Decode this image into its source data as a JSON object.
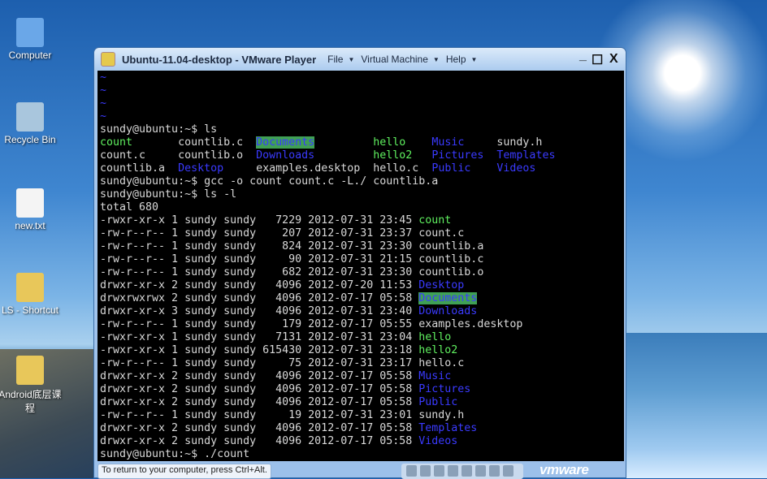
{
  "desktop": {
    "icons": [
      {
        "label": "Computer",
        "color": "#6aa7e8"
      },
      {
        "label": "Recycle Bin",
        "color": "#a9c6dd"
      },
      {
        "label": "new.txt",
        "color": "#f4f4f4"
      },
      {
        "label": "LS - Shortcut",
        "color": "#e8c75a"
      },
      {
        "label": "Android底层课程",
        "color": "#e8c75a"
      }
    ]
  },
  "window": {
    "title": "Ubuntu-11.04-desktop - VMware Player",
    "menus": [
      "File",
      "Virtual Machine",
      "Help"
    ],
    "minimize": "_",
    "maximize": "☐",
    "close": "X"
  },
  "status": {
    "message": "To return to your computer, press Ctrl+Alt.",
    "logo": "vmware"
  },
  "colors": {
    "green": "#5ff05f",
    "blue": "#3a3aff",
    "dir_hl_bg": "#3fa055",
    "tilde": "#3a3aff",
    "text": "#d8d8d8"
  },
  "terminal": {
    "lines": [
      [
        {
          "t": "~",
          "c": "tilde"
        }
      ],
      [
        {
          "t": "~",
          "c": "tilde"
        }
      ],
      [
        {
          "t": "~",
          "c": "tilde"
        }
      ],
      [
        {
          "t": "~",
          "c": "tilde"
        }
      ],
      [
        {
          "t": "sundy@ubuntu:~$ ls"
        }
      ],
      [
        {
          "t": "count",
          "c": "green"
        },
        {
          "t": "       countlib.c  "
        },
        {
          "t": "Documents",
          "c": "hl"
        },
        {
          "t": "         "
        },
        {
          "t": "hello",
          "c": "green"
        },
        {
          "t": "    "
        },
        {
          "t": "Music",
          "c": "blue"
        },
        {
          "t": "     sundy.h"
        }
      ],
      [
        {
          "t": "count.c     countlib.o  "
        },
        {
          "t": "Downloads",
          "c": "blue"
        },
        {
          "t": "         "
        },
        {
          "t": "hello2",
          "c": "green"
        },
        {
          "t": "   "
        },
        {
          "t": "Pictures",
          "c": "blue"
        },
        {
          "t": "  "
        },
        {
          "t": "Templates",
          "c": "blue"
        }
      ],
      [
        {
          "t": "countlib.a  "
        },
        {
          "t": "Desktop",
          "c": "blue"
        },
        {
          "t": "     examples.desktop  hello.c  "
        },
        {
          "t": "Public",
          "c": "blue"
        },
        {
          "t": "    "
        },
        {
          "t": "Videos",
          "c": "blue"
        }
      ],
      [
        {
          "t": "sundy@ubuntu:~$ gcc -o count count.c -L./ countlib.a"
        }
      ],
      [
        {
          "t": "sundy@ubuntu:~$ ls -l"
        }
      ],
      [
        {
          "t": "total 680"
        }
      ],
      [
        {
          "t": "-rwxr-xr-x 1 sundy sundy   7229 2012-07-31 23:45 "
        },
        {
          "t": "count",
          "c": "green"
        }
      ],
      [
        {
          "t": "-rw-r--r-- 1 sundy sundy    207 2012-07-31 23:37 count.c"
        }
      ],
      [
        {
          "t": "-rw-r--r-- 1 sundy sundy    824 2012-07-31 23:30 countlib.a"
        }
      ],
      [
        {
          "t": "-rw-r--r-- 1 sundy sundy     90 2012-07-31 21:15 countlib.c"
        }
      ],
      [
        {
          "t": "-rw-r--r-- 1 sundy sundy    682 2012-07-31 23:30 countlib.o"
        }
      ],
      [
        {
          "t": "drwxr-xr-x 2 sundy sundy   4096 2012-07-20 11:53 "
        },
        {
          "t": "Desktop",
          "c": "blue"
        }
      ],
      [
        {
          "t": "drwxrwxrwx 2 sundy sundy   4096 2012-07-17 05:58 "
        },
        {
          "t": "Documents",
          "c": "hl"
        }
      ],
      [
        {
          "t": "drwxr-xr-x 3 sundy sundy   4096 2012-07-31 23:40 "
        },
        {
          "t": "Downloads",
          "c": "blue"
        }
      ],
      [
        {
          "t": "-rw-r--r-- 1 sundy sundy    179 2012-07-17 05:55 examples.desktop"
        }
      ],
      [
        {
          "t": "-rwxr-xr-x 1 sundy sundy   7131 2012-07-31 23:04 "
        },
        {
          "t": "hello",
          "c": "green"
        }
      ],
      [
        {
          "t": "-rwxr-xr-x 1 sundy sundy 615430 2012-07-31 23:18 "
        },
        {
          "t": "hello2",
          "c": "green"
        }
      ],
      [
        {
          "t": "-rw-r--r-- 1 sundy sundy     75 2012-07-31 23:17 hello.c"
        }
      ],
      [
        {
          "t": "drwxr-xr-x 2 sundy sundy   4096 2012-07-17 05:58 "
        },
        {
          "t": "Music",
          "c": "blue"
        }
      ],
      [
        {
          "t": "drwxr-xr-x 2 sundy sundy   4096 2012-07-17 05:58 "
        },
        {
          "t": "Pictures",
          "c": "blue"
        }
      ],
      [
        {
          "t": "drwxr-xr-x 2 sundy sundy   4096 2012-07-17 05:58 "
        },
        {
          "t": "Public",
          "c": "blue"
        }
      ],
      [
        {
          "t": "-rw-r--r-- 1 sundy sundy     19 2012-07-31 23:01 sundy.h"
        }
      ],
      [
        {
          "t": "drwxr-xr-x 2 sundy sundy   4096 2012-07-17 05:58 "
        },
        {
          "t": "Templates",
          "c": "blue"
        }
      ],
      [
        {
          "t": "drwxr-xr-x 2 sundy sundy   4096 2012-07-17 05:58 "
        },
        {
          "t": "Videos",
          "c": "blue"
        }
      ],
      [
        {
          "t": "sundy@ubuntu:~$ ./count"
        }
      ]
    ]
  }
}
